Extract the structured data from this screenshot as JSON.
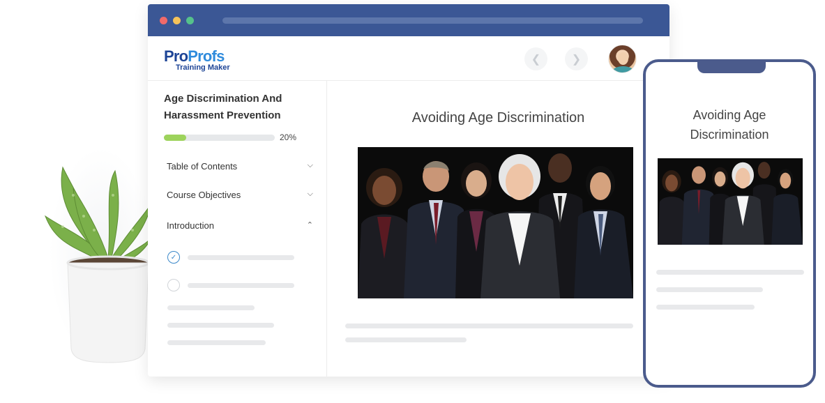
{
  "brand": {
    "logo_main_1": "Pro",
    "logo_main_2": "Profs",
    "logo_sub": "Training Maker"
  },
  "course": {
    "title": "Age Discrimination And Harassment Prevention",
    "progress_percent": 20,
    "progress_label": "20%"
  },
  "sidebar": {
    "sections": [
      {
        "label": "Table of Contents",
        "state": "collapsed"
      },
      {
        "label": "Course Objectives",
        "state": "collapsed"
      },
      {
        "label": "Introduction",
        "state": "expanded"
      }
    ],
    "lessons": [
      {
        "status": "completed"
      },
      {
        "status": "not-started"
      }
    ]
  },
  "slide": {
    "title": "Avoiding Age Discrimination"
  },
  "mobile": {
    "title": "Avoiding Age Discrimination"
  },
  "colors": {
    "titlebar": "#3b5795",
    "progress": "#9dd35c",
    "phone_frame": "#4b5b8c",
    "check": "#3b88c9"
  }
}
